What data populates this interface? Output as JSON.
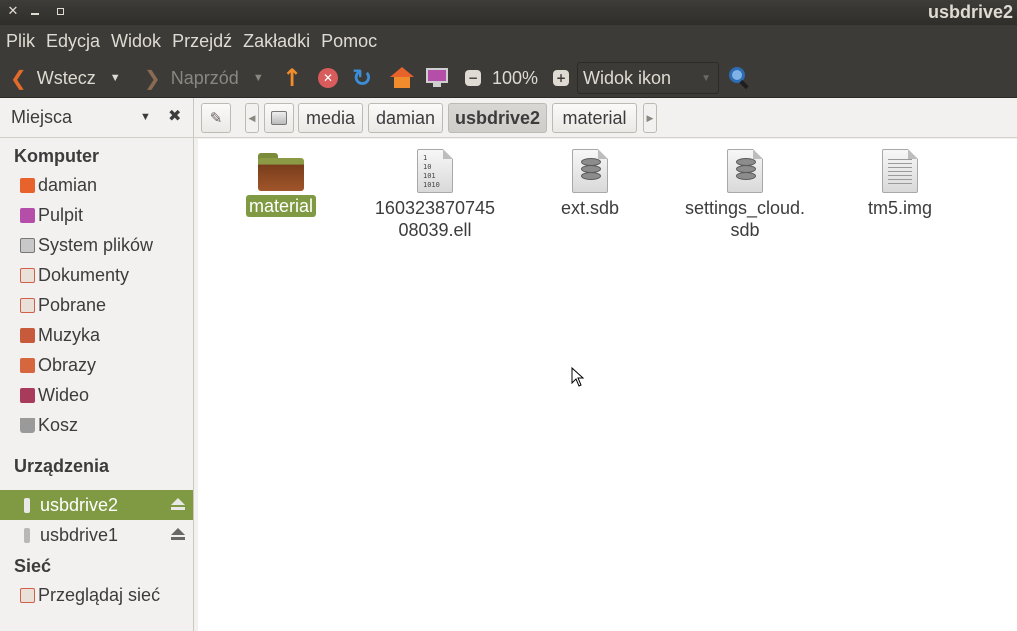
{
  "window": {
    "title": "usbdrive2"
  },
  "menubar": {
    "items": [
      "Plik",
      "Edycja",
      "Widok",
      "Przejdź",
      "Zakładki",
      "Pomoc"
    ]
  },
  "toolbar": {
    "back_label": "Wstecz",
    "forward_label": "Naprzód",
    "zoom_level": "100%",
    "view_mode": "Widok ikon"
  },
  "places_header": {
    "label": "Miejsca"
  },
  "pathbar": {
    "segments": [
      "media",
      "damian",
      "usbdrive2",
      "material"
    ],
    "active": "usbdrive2"
  },
  "sidebar": {
    "sections": [
      {
        "title": "Komputer",
        "items": [
          {
            "label": "damian",
            "icon": "home-icon"
          },
          {
            "label": "Pulpit",
            "icon": "desktop-icon"
          },
          {
            "label": "System plików",
            "icon": "filesystem-icon"
          },
          {
            "label": "Dokumenty",
            "icon": "documents-icon"
          },
          {
            "label": "Pobrane",
            "icon": "downloads-icon"
          },
          {
            "label": "Muzyka",
            "icon": "music-icon"
          },
          {
            "label": "Obrazy",
            "icon": "pictures-icon"
          },
          {
            "label": "Wideo",
            "icon": "video-icon"
          },
          {
            "label": "Kosz",
            "icon": "trash-icon"
          }
        ]
      },
      {
        "title": "Urządzenia",
        "items": [
          {
            "label": "usbdrive2",
            "icon": "usb-drive-icon",
            "selected": true
          },
          {
            "label": "usbdrive1",
            "icon": "usb-drive-icon",
            "selected": false
          }
        ]
      },
      {
        "title": "Sieć",
        "items": [
          {
            "label": "Przeglądaj sieć",
            "icon": "network-icon"
          }
        ]
      }
    ]
  },
  "files": [
    {
      "name": "material",
      "type": "folder",
      "selected": true
    },
    {
      "name_line1": "160323870745",
      "name_line2": "08039.ell",
      "type": "binary"
    },
    {
      "name": "ext.sdb",
      "type": "database"
    },
    {
      "name_line1": "settings_cloud.",
      "name_line2": "sdb",
      "type": "database"
    },
    {
      "name": "tm5.img",
      "type": "text"
    }
  ],
  "colors": {
    "selection": "#7f9a42",
    "chrome_dark": "#3c3b37",
    "accent_orange": "#e26b2c"
  }
}
